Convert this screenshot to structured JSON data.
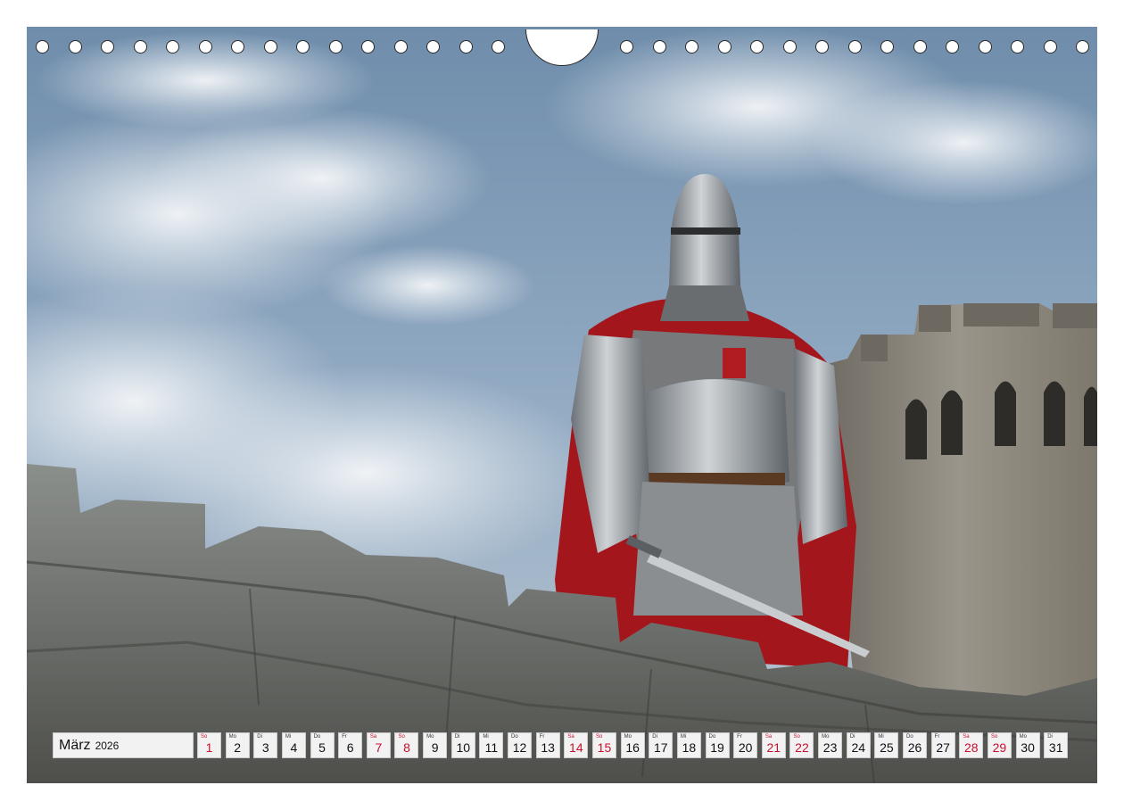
{
  "calendar": {
    "month": "März",
    "year": "2026",
    "days": [
      {
        "wd": "So",
        "d": "1",
        "we": true
      },
      {
        "wd": "Mo",
        "d": "2",
        "we": false
      },
      {
        "wd": "Di",
        "d": "3",
        "we": false
      },
      {
        "wd": "Mi",
        "d": "4",
        "we": false
      },
      {
        "wd": "Do",
        "d": "5",
        "we": false
      },
      {
        "wd": "Fr",
        "d": "6",
        "we": false
      },
      {
        "wd": "Sa",
        "d": "7",
        "we": true
      },
      {
        "wd": "So",
        "d": "8",
        "we": true
      },
      {
        "wd": "Mo",
        "d": "9",
        "we": false
      },
      {
        "wd": "Di",
        "d": "10",
        "we": false
      },
      {
        "wd": "Mi",
        "d": "11",
        "we": false
      },
      {
        "wd": "Do",
        "d": "12",
        "we": false
      },
      {
        "wd": "Fr",
        "d": "13",
        "we": false
      },
      {
        "wd": "Sa",
        "d": "14",
        "we": true
      },
      {
        "wd": "So",
        "d": "15",
        "we": true
      },
      {
        "wd": "Mo",
        "d": "16",
        "we": false
      },
      {
        "wd": "Di",
        "d": "17",
        "we": false
      },
      {
        "wd": "Mi",
        "d": "18",
        "we": false
      },
      {
        "wd": "Do",
        "d": "19",
        "we": false
      },
      {
        "wd": "Fr",
        "d": "20",
        "we": false
      },
      {
        "wd": "Sa",
        "d": "21",
        "we": true
      },
      {
        "wd": "So",
        "d": "22",
        "we": true
      },
      {
        "wd": "Mo",
        "d": "23",
        "we": false
      },
      {
        "wd": "Di",
        "d": "24",
        "we": false
      },
      {
        "wd": "Mi",
        "d": "25",
        "we": false
      },
      {
        "wd": "Do",
        "d": "26",
        "we": false
      },
      {
        "wd": "Fr",
        "d": "27",
        "we": false
      },
      {
        "wd": "Sa",
        "d": "28",
        "we": true
      },
      {
        "wd": "So",
        "d": "29",
        "we": true
      },
      {
        "wd": "Mo",
        "d": "30",
        "we": false
      },
      {
        "wd": "Di",
        "d": "31",
        "we": false
      }
    ]
  },
  "binding": {
    "hole_count_left": 15,
    "hole_count_right": 15
  },
  "colors": {
    "weekend": "#c8102e",
    "cape": "#a3161c",
    "sky": "#7f9bb7"
  }
}
